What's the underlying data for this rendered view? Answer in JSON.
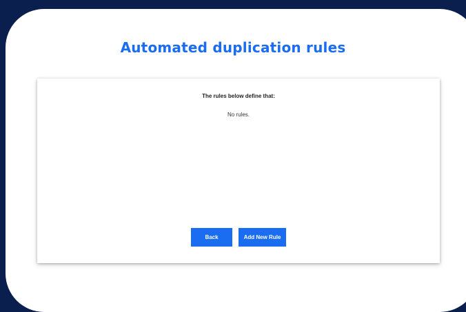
{
  "page": {
    "title": "Automated duplication rules"
  },
  "rules_panel": {
    "heading": "The rules below define that:",
    "empty_message": "No rules.",
    "rules": []
  },
  "actions": {
    "back_label": "Back",
    "add_rule_label": "Add New Rule"
  },
  "colors": {
    "background": "#0b1f4f",
    "accent": "#1a6cf0",
    "surface": "#ffffff"
  }
}
